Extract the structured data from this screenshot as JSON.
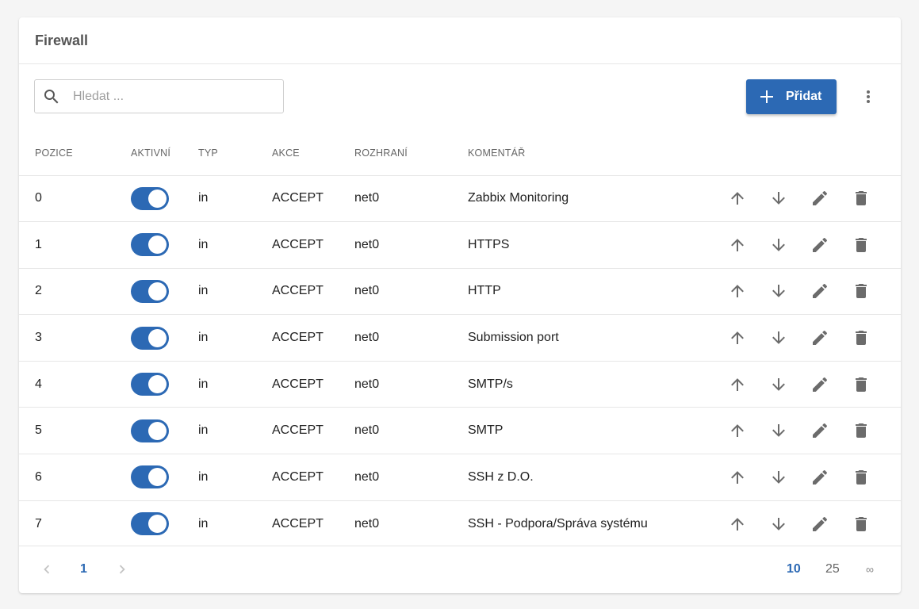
{
  "card": {
    "title": "Firewall"
  },
  "search": {
    "placeholder": "Hledat ...",
    "icon": "search-icon"
  },
  "toolbar": {
    "add_label": "Přidat",
    "add_icon": "plus-icon",
    "more_icon": "more-vert-icon"
  },
  "colors": {
    "accent": "#2c69b4",
    "icon": "#6b6b6b",
    "divider": "#e6e6e6"
  },
  "table": {
    "headers": {
      "pozice": "POZICE",
      "aktivni": "AKTIVNÍ",
      "typ": "TYP",
      "akce": "AKCE",
      "rozhrani": "ROZHRANÍ",
      "komentar": "KOMENTÁŘ"
    },
    "rows": [
      {
        "pozice": "0",
        "aktivni": true,
        "typ": "in",
        "akce": "ACCEPT",
        "rozhrani": "net0",
        "komentar": "Zabbix Monitoring"
      },
      {
        "pozice": "1",
        "aktivni": true,
        "typ": "in",
        "akce": "ACCEPT",
        "rozhrani": "net0",
        "komentar": "HTTPS"
      },
      {
        "pozice": "2",
        "aktivni": true,
        "typ": "in",
        "akce": "ACCEPT",
        "rozhrani": "net0",
        "komentar": "HTTP"
      },
      {
        "pozice": "3",
        "aktivni": true,
        "typ": "in",
        "akce": "ACCEPT",
        "rozhrani": "net0",
        "komentar": "Submission port"
      },
      {
        "pozice": "4",
        "aktivni": true,
        "typ": "in",
        "akce": "ACCEPT",
        "rozhrani": "net0",
        "komentar": "SMTP/s"
      },
      {
        "pozice": "5",
        "aktivni": true,
        "typ": "in",
        "akce": "ACCEPT",
        "rozhrani": "net0",
        "komentar": "SMTP"
      },
      {
        "pozice": "6",
        "aktivni": true,
        "typ": "in",
        "akce": "ACCEPT",
        "rozhrani": "net0",
        "komentar": "SSH z D.O."
      },
      {
        "pozice": "7",
        "aktivni": true,
        "typ": "in",
        "akce": "ACCEPT",
        "rozhrani": "net0",
        "komentar": "SSH - Podpora/Správa systému"
      }
    ],
    "row_action_icons": [
      "arrow-up-icon",
      "arrow-down-icon",
      "pencil-icon",
      "trash-icon"
    ]
  },
  "pagination": {
    "prev_icon": "chevron-left-icon",
    "current_page": "1",
    "next_icon": "chevron-right-icon",
    "page_sizes": [
      "10",
      "25",
      "∞"
    ],
    "selected_page_size": "10"
  }
}
